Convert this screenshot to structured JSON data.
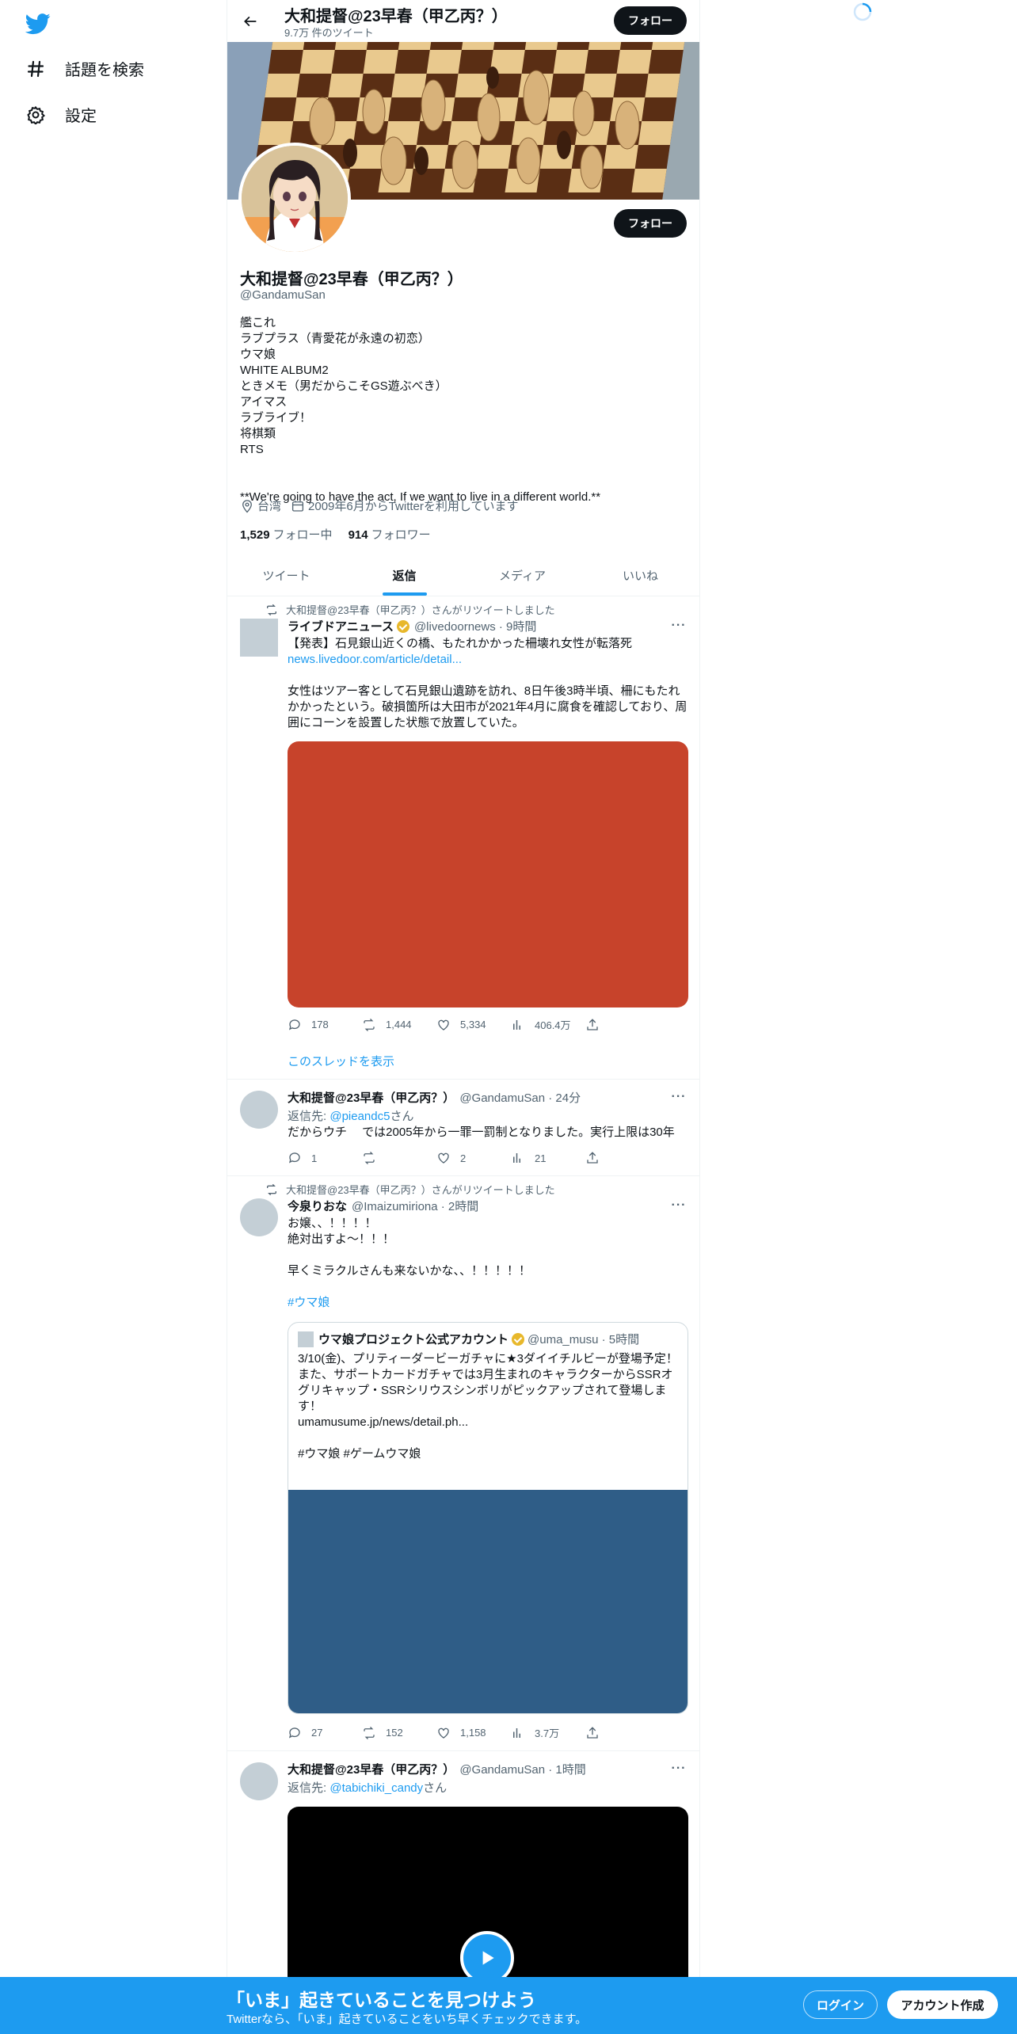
{
  "nav": {
    "explore_label": "話題を検索",
    "settings_label": "設定"
  },
  "header": {
    "title": "大和提督@23早春（甲乙丙？）",
    "tweet_count": "9.7万 件のツイート",
    "follow_label": "フォロー"
  },
  "profile": {
    "follow_label": "フォロー",
    "name": "大和提督@23早春（甲乙丙？）",
    "handle": "@GandamuSan",
    "bio": "艦これ\nラブプラス（青愛花が永遠の初恋）\nウマ娘\nWHITE ALBUM2\nときメモ（男だからこそGS遊ぶべき）\nアイマス\nラブライブ！\n将棋類\nRTS\n\n\n**We're going to have the act, If we want to live in a different world.**",
    "location": "台湾",
    "joined": "2009年6月からTwitterを利用しています",
    "following_count": "1,529",
    "following_label": "フォロー中",
    "followers_count": "914",
    "followers_label": "フォロワー"
  },
  "tabs": [
    {
      "label": "ツイート"
    },
    {
      "label": "返信",
      "active": true
    },
    {
      "label": "メディア"
    },
    {
      "label": "いいね"
    }
  ],
  "tweets": [
    {
      "retweet_text": "大和提督@23早春（甲乙丙？）さんがリツイートしました",
      "name": "ライブドアニュース",
      "handle": "@livedoornews · 9時間",
      "text1": "【発表】石見銀山近くの橋、もたれかかった柵壊れ女性が転落死",
      "link": "news.livedoor.com/article/detail...",
      "text2": "女性はツアー客として石見銀山遺跡を訪れ、8日午後3時半頃、柵にもたれかかったという。破損箇所は大田市が2021年4月に腐食を確認しており、周囲にコーンを設置した状態で放置していた。",
      "replies": "178",
      "retweets": "1,444",
      "likes": "5,334",
      "views": "406.4万",
      "show_thread": "このスレッドを表示",
      "media_color": "#c7432b"
    },
    {
      "name": "大和提督@23早春（甲乙丙？）",
      "handle": "@GandamuSan · 24分",
      "reply_prefix": "返信先: ",
      "reply_to": "@pieandc5",
      "reply_suffix": "さん",
      "text": "だからウチ　 では2005年から一罪一罰制となりました。実行上限は30年",
      "replies": "1",
      "retweets": "",
      "likes": "2",
      "views": "21"
    },
    {
      "retweet_text": "大和提督@23早春（甲乙丙？）さんがリツイートしました",
      "name": "今泉りおな",
      "handle": "@Imaizumiriona · 2時間",
      "text": "お嬢、、！！！！\n絶対出すよ〜！！！\n\n早くミラクルさんも来ないかな、、！！！！！",
      "hashtag": "#ウマ娘",
      "quote": {
        "name": "ウマ娘プロジェクト公式アカウント",
        "handle": "@uma_musu · 5時間",
        "text": "3/10(金)、プリティーダービーガチャに★3ダイイチルビーが登場予定！\nまた、サポートカードガチャでは3月生まれのキャラクターからSSRオグリキャップ・SSRシリウスシンボリがピックアップされて登場します！\numamusume.jp/news/detail.ph...\n\n#ウマ娘 #ゲームウマ娘",
        "media_color": "#2f5d87"
      },
      "replies": "27",
      "retweets": "152",
      "likes": "1,158",
      "views": "3.7万"
    },
    {
      "name": "大和提督@23早春（甲乙丙？）",
      "handle": "@GandamuSan · 1時間",
      "reply_prefix": "返信先: ",
      "reply_to": "@tabichiki_candy",
      "reply_suffix": "さん"
    }
  ],
  "bottom_bar": {
    "title": "「いま」起きていることを見つけよう",
    "subtitle": "Twitterなら、「いま」起きていることをいち早くチェックできます。",
    "login_label": "ログイン",
    "signup_label": "アカウント作成"
  },
  "colors": {
    "accent": "#1d9bf0",
    "text": "#0f1419",
    "secondary": "#536471"
  }
}
